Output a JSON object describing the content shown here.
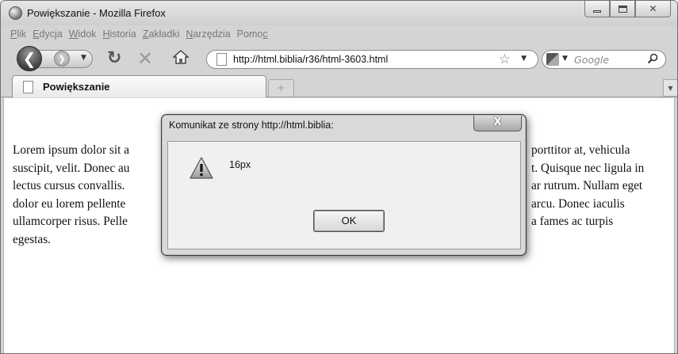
{
  "window": {
    "title": "Powiększanie - Mozilla Firefox",
    "controls": {
      "minimize": "",
      "maximize": "",
      "close": "✕"
    }
  },
  "menubar": {
    "items": [
      {
        "label": "Plik",
        "accel": "P",
        "rest": "lik"
      },
      {
        "label": "Edycja",
        "accel": "E",
        "rest": "dycja"
      },
      {
        "label": "Widok",
        "accel": "W",
        "rest": "idok"
      },
      {
        "label": "Historia",
        "accel": "H",
        "rest": "istoria"
      },
      {
        "label": "Zakładki",
        "accel": "Z",
        "rest": "akładki"
      },
      {
        "label": "Narzędzia",
        "accel": "N",
        "rest": "arzędzia"
      },
      {
        "label": "Pomoc",
        "pre": "Pomo",
        "accel": "c"
      }
    ]
  },
  "navbar": {
    "url": "http://html.biblia/r36/html-3603.html",
    "search_placeholder": "Google",
    "icons": [
      "back-icon",
      "forward-icon",
      "reload-icon",
      "stop-icon",
      "home-icon",
      "bookmark-star-icon",
      "search-icon"
    ]
  },
  "tabs": [
    {
      "label": "Powiększanie",
      "active": true
    }
  ],
  "content": {
    "text": "Lorem ipsum dolor sit a porttitor at, vehicula suscipit, velit. Donec au t. Quisque nec ligula in lectus cursus convallis. ar rutrum. Nullam eget dolor eu lorem pellente arcu. Donec iaculis ullamcorper risus. Pelle a fames ac turpis egestas.",
    "lines": [
      {
        "left": "Lorem ipsum dolor sit a",
        "right": "porttitor at, vehicula"
      },
      {
        "left": "suscipit, velit. Donec au",
        "right": "t. Quisque nec ligula in"
      },
      {
        "left": "lectus cursus convallis.",
        "right": "ar rutrum. Nullam eget"
      },
      {
        "left": "dolor eu lorem pellente",
        "right": "arcu. Donec iaculis"
      },
      {
        "left": "ullamcorper risus. Pelle",
        "right": "a fames ac turpis"
      },
      {
        "left": "egestas.",
        "right": ""
      }
    ]
  },
  "dialog": {
    "title": "Komunikat ze strony http://html.biblia:",
    "message": "16px",
    "ok_label": "OK",
    "close_label": "X",
    "icon": "warning-icon"
  }
}
